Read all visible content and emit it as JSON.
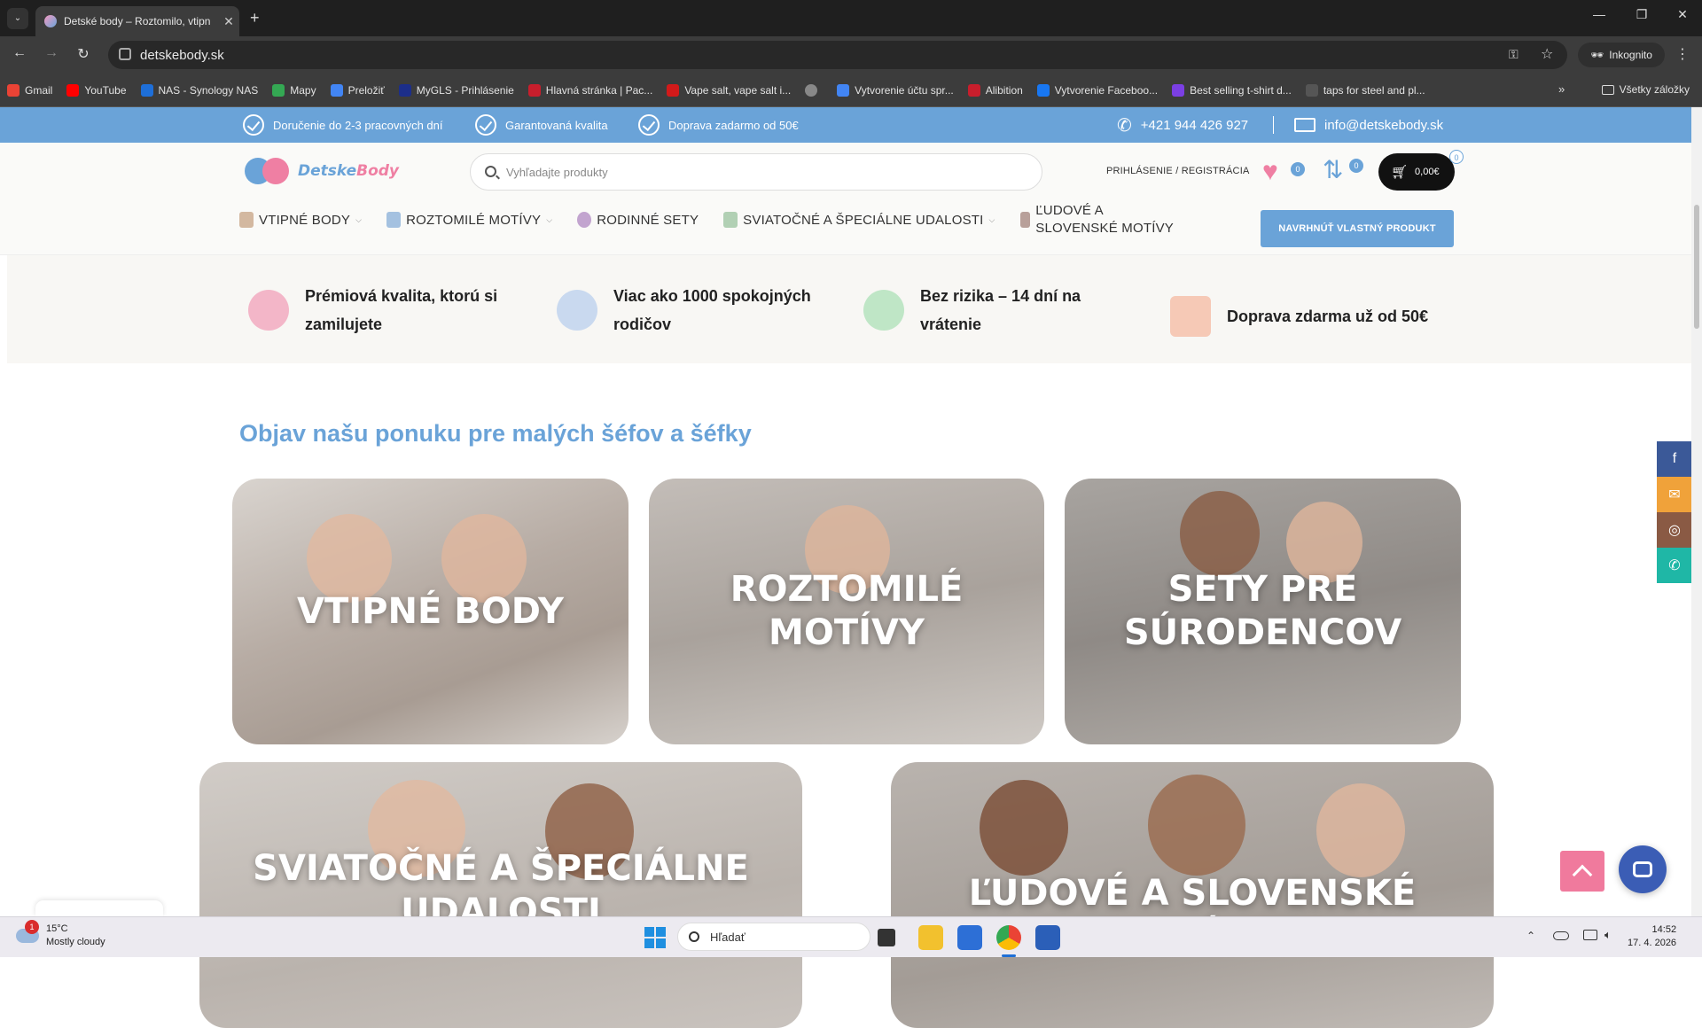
{
  "browser": {
    "tab_title": "Detské body – Roztomilo, vtipn",
    "url": "detskebody.sk",
    "incognito_label": "Inkognito",
    "bookmarks": [
      {
        "label": "Gmail",
        "color": "#ea4335"
      },
      {
        "label": "YouTube",
        "color": "#ff0000"
      },
      {
        "label": "NAS - Synology NAS",
        "color": "#1e6fd9"
      },
      {
        "label": "Mapy",
        "color": "#34a853"
      },
      {
        "label": "Preložiť",
        "color": "#4285f4"
      },
      {
        "label": "MyGLS - Prihlásenie",
        "color": "#1c2e8a"
      },
      {
        "label": "Hlavná stránka | Pac...",
        "color": "#c81e2c"
      },
      {
        "label": "Vape salt, vape salt i...",
        "color": "#d21a1a"
      },
      {
        "label": "",
        "color": "#888888"
      },
      {
        "label": "Vytvorenie účtu spr...",
        "color": "#4285f4"
      },
      {
        "label": "Alibition",
        "color": "#c81e2c"
      },
      {
        "label": "Vytvorenie Faceboo...",
        "color": "#1877f2"
      },
      {
        "label": "Best selling t-shirt d...",
        "color": "#7b3fe4"
      },
      {
        "label": "taps for steel and pl...",
        "color": "#555555"
      }
    ],
    "all_bookmarks": "Všetky záložky"
  },
  "topbar": {
    "items": [
      "Doručenie do 2-3 pracovných dní",
      "Garantovaná kvalita",
      "Doprava zadarmo od 50€"
    ],
    "phone": "+421 944 426 927",
    "email": "info@detskebody.sk"
  },
  "header": {
    "logo_part1": "Detske",
    "logo_part2": "Body",
    "search_placeholder": "Vyhľadajte produkty",
    "login": "PRIHLÁSENIE / REGISTRÁCIA",
    "wishlist_count": "0",
    "compare_count": "0",
    "cart_count": "0",
    "cart_total": "0,00€",
    "menu": [
      {
        "label": "Vtipné body",
        "dropdown": true
      },
      {
        "label": "Roztomilé motívy",
        "dropdown": true
      },
      {
        "label": "Rodinné sety",
        "dropdown": false
      },
      {
        "label": "Sviatočné a špeciálne udalosti",
        "dropdown": true
      },
      {
        "label": "Ľudové a slovenské motívy",
        "dropdown": false
      }
    ],
    "design_button": "NAVRHNÚŤ VLASTNÝ PRODUKT"
  },
  "features": [
    {
      "l1": "Prémiová kvalita, ktorú si",
      "l2": "zamilujete",
      "icon": "ribbon-icon",
      "color": "#f3b6c8"
    },
    {
      "l1": "Viac ako 1000 spokojných",
      "l2": "rodičov",
      "icon": "people-icon",
      "color": "#c9d9ef"
    },
    {
      "l1": "Bez rizika – 14 dní na",
      "l2": "vrátenie",
      "icon": "return-icon",
      "color": "#bfe6c6"
    },
    {
      "l1": "Doprava zdarma už od 50€",
      "l2": "",
      "icon": "package-icon",
      "color": "#f6c9b6"
    }
  ],
  "section_title": "Objav našu ponuku pre malých šéfov a šéfky",
  "categories": [
    {
      "l1": "VTIPNÉ BODY",
      "l2": ""
    },
    {
      "l1": "ROZTOMILÉ",
      "l2": "MOTÍVY"
    },
    {
      "l1": "SETY PRE",
      "l2": "SÚRODENCOV"
    },
    {
      "l1": "SVIATOČNÉ A ŠPECIÁLNE",
      "l2": "UDALOSTI"
    },
    {
      "l1": "ĽUDOVÉ A SLOVENSKÉ MOTÍVY",
      "l2": ""
    }
  ],
  "social": [
    {
      "icon": "facebook-icon",
      "glyph": "f",
      "color": "#3b5998"
    },
    {
      "icon": "email-icon",
      "glyph": "✉",
      "color": "#f0a23a"
    },
    {
      "icon": "instagram-icon",
      "glyph": "◎",
      "color": "#8a5a44"
    },
    {
      "icon": "whatsapp-icon",
      "glyph": "✆",
      "color": "#1fb7a6"
    }
  ],
  "taskbar": {
    "weather_temp": "15°C",
    "weather_desc": "Mostly cloudy",
    "weather_badge": "1",
    "search": "Hľadať",
    "time": "14:52",
    "date": "17. 4. 2026"
  }
}
